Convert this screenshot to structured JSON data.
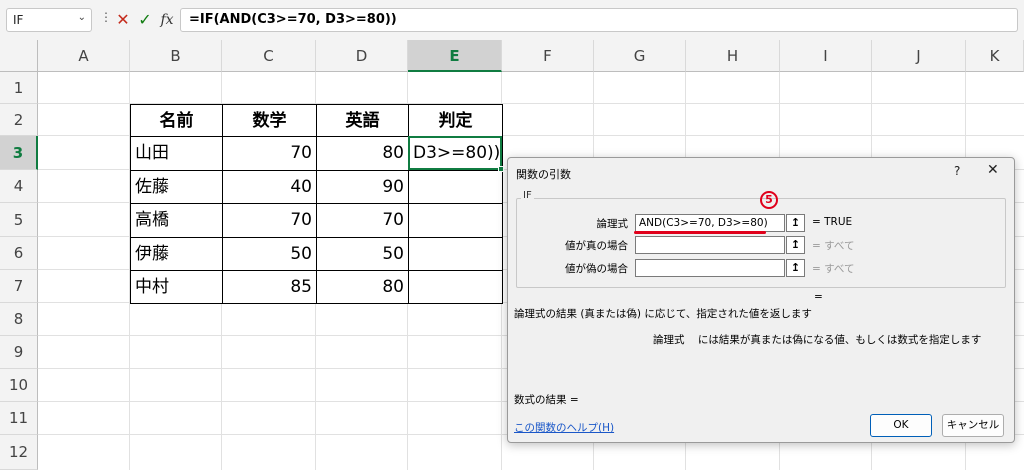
{
  "formula_bar": {
    "name_box": "IF",
    "cancel_glyph": "✕",
    "enter_glyph": "✓",
    "fx_label": "fx",
    "formula": "=IF(AND(C3>=70, D3>=80))"
  },
  "columns": [
    "A",
    "B",
    "C",
    "D",
    "E",
    "F",
    "G",
    "H",
    "I",
    "J",
    "K"
  ],
  "rows": [
    "1",
    "2",
    "3",
    "4",
    "5",
    "6",
    "7",
    "8",
    "9",
    "10",
    "11",
    "12"
  ],
  "selected_column": "E",
  "selected_row": "3",
  "table": {
    "headers": [
      "名前",
      "数学",
      "英語",
      "判定"
    ],
    "rows": [
      [
        "山田",
        "70",
        "80"
      ],
      [
        "佐藤",
        "40",
        "90"
      ],
      [
        "高橋",
        "70",
        "70"
      ],
      [
        "伊藤",
        "50",
        "50"
      ],
      [
        "中村",
        "85",
        "80"
      ]
    ],
    "active_cell_text": "D3>=80))"
  },
  "dialog": {
    "title": "関数の引数",
    "help_glyph": "?",
    "close_glyph": "✕",
    "function_name": "IF",
    "badge": "5",
    "args": [
      {
        "label": "論理式",
        "value": "AND(C3>=70, D3>=80)",
        "result": "= TRUE",
        "dim": false
      },
      {
        "label": "値が真の場合",
        "value": "",
        "result": "= すべて",
        "dim": true
      },
      {
        "label": "値が偽の場合",
        "value": "",
        "result": "= すべて",
        "dim": true
      }
    ],
    "ref_glyph": "↥",
    "eq": "=",
    "description": "論理式の結果 (真または偽) に応じて、指定された値を返します",
    "arg_desc_name": "論理式",
    "arg_desc_text": "には結果が真または偽になる値、もしくは数式を指定します",
    "formula_result": "数式の結果 =",
    "help_link": "この関数のヘルプ(H)",
    "ok": "OK",
    "cancel": "キャンセル"
  }
}
